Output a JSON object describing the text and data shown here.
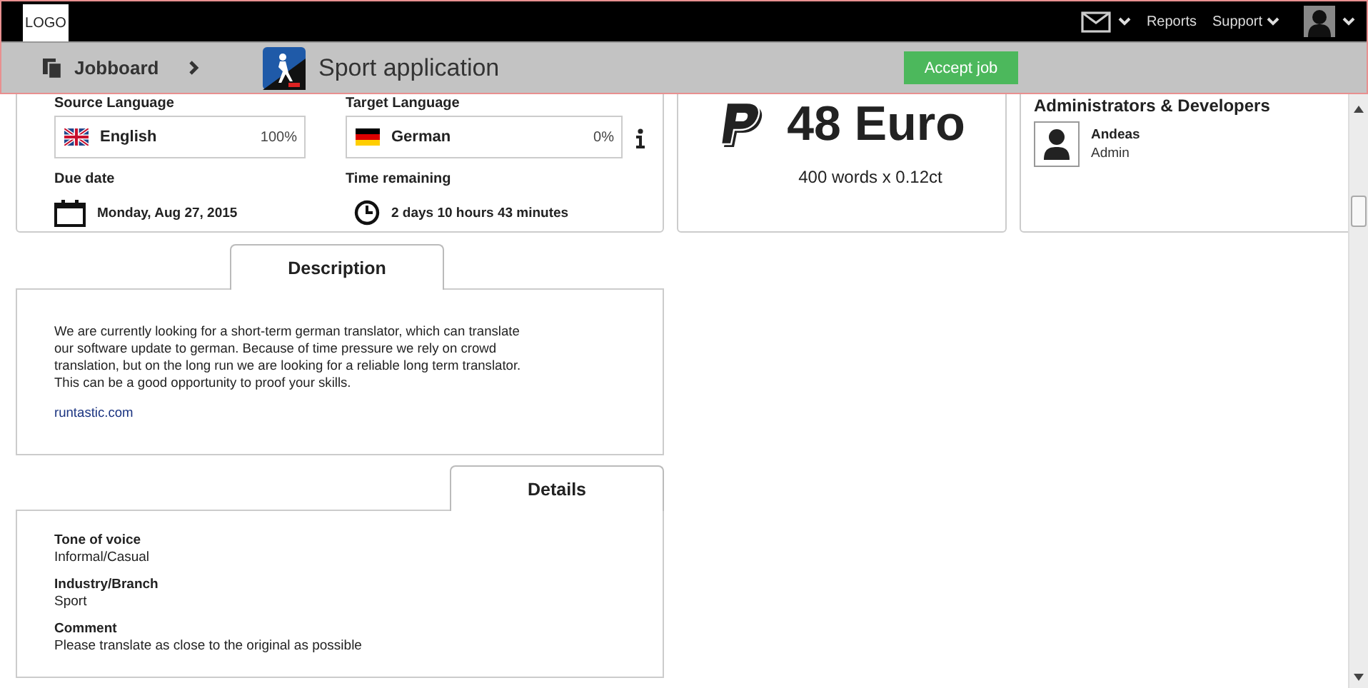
{
  "header": {
    "logo": "LOGO",
    "nav": [
      {
        "label": "Reports"
      },
      {
        "label": "Support"
      }
    ]
  },
  "breadcrumb": {
    "root": "Jobboard",
    "title": "Sport application",
    "action": "Accept job"
  },
  "job": {
    "languages": [
      {
        "label": "Source Language",
        "language": "English",
        "percent": "100%"
      },
      {
        "label": "Target Language",
        "language": "German",
        "percent": "0%"
      }
    ],
    "due": {
      "label": "Due date",
      "value": "Monday, Aug 27, 2015"
    },
    "remaining": {
      "label": "Time remaining",
      "value": "2 days 10 hours 43 minutes"
    }
  },
  "price": {
    "amount": "48 Euro",
    "calculation": "400 words x 0.12ct"
  },
  "team": {
    "title": "Administrators & Developers",
    "members": [
      {
        "name": "Andeas",
        "role": "Admin"
      }
    ]
  },
  "description": {
    "tab": "Description",
    "text": "We are currently looking for a short-term german translator, which can translate our software update to german. Because of time pressure we rely on crowd translation, but on the long run we are looking for a reliable long term translator. This can be a good opportunity to proof your skills.",
    "link": "runtastic.com"
  },
  "details": {
    "tab": "Details",
    "fields": [
      {
        "label": "Tone of voice",
        "value": "Informal/Casual"
      },
      {
        "label": "Industry/Branch",
        "value": "Sport"
      },
      {
        "label": "Comment",
        "value": "Please translate as close to the original as possible"
      }
    ]
  }
}
